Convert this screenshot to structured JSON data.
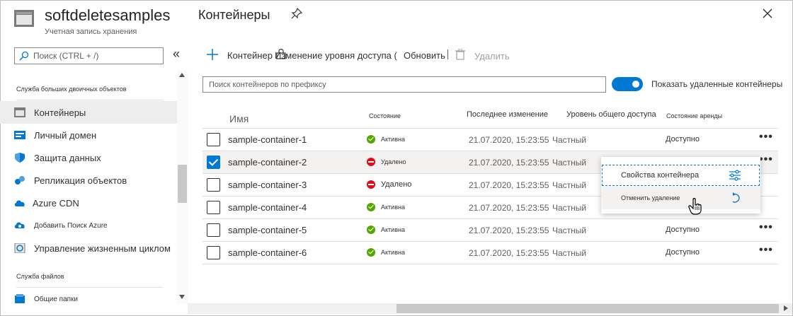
{
  "resource": {
    "title": "softdeletesamples",
    "subtitle": "Учетная запись хранения"
  },
  "page": {
    "title": "Контейнеры"
  },
  "sidebar": {
    "search_placeholder": "Поиск (CTRL + /)",
    "collapse_label": "«",
    "section_blob": "Служба больших двоичных объектов",
    "items": [
      {
        "label": "Контейнеры",
        "icon": "container-icon",
        "selected": true
      },
      {
        "label": "Личный домен",
        "icon": "custom-domain-icon"
      },
      {
        "label": "Защита данных",
        "icon": "shield-icon"
      },
      {
        "label": "Репликация объектов",
        "icon": "replication-icon"
      },
      {
        "label": "Azure CDN",
        "icon": "cloud-icon"
      },
      {
        "label": "Добавить Поиск Azure",
        "icon": "cloud-search-icon"
      },
      {
        "label": "Управление жизненным циклом",
        "icon": "lifecycle-icon"
      }
    ],
    "section_files": "Служба файлов",
    "file_items": [
      {
        "label": "Общие папки",
        "icon": "file-share-icon"
      }
    ]
  },
  "toolbar": {
    "add_container": "Контейнер",
    "change_access": "Изменение уровня доступа (",
    "refresh": "Обновить",
    "delete": "Удалить"
  },
  "filter": {
    "placeholder": "Поиск контейнеров по префиксу",
    "show_deleted_label": "Показать удаленные контейнеры",
    "show_deleted_on": true
  },
  "table": {
    "headers": {
      "name": "Имя",
      "state": "Состояние",
      "modified": "Последнее изменение",
      "access": "Уровень общего доступа",
      "lease": "Состояние аренды"
    },
    "rows": [
      {
        "name": "sample-container-1",
        "state": "Активна",
        "status": "ok",
        "modified": "21.07.2020, 15:23:55",
        "access": "Частный",
        "lease": "Доступно",
        "checked": false
      },
      {
        "name": "sample-container-2",
        "state": "Удалено",
        "status": "deleted",
        "modified": "21.07.2020, 15:23:55",
        "access": "Частный",
        "lease": "",
        "checked": true
      },
      {
        "name": "sample-container-3",
        "state": "Удалено",
        "status": "deleted",
        "modified": "21.07.2020, 15:23:55",
        "access": "Частный",
        "lease": "",
        "checked": false
      },
      {
        "name": "sample-container-4",
        "state": "Активна",
        "status": "ok",
        "modified": "21.07.2020, 15:23:55",
        "access": "Частный",
        "lease": "",
        "checked": false
      },
      {
        "name": "sample-container-5",
        "state": "Активна",
        "status": "ok",
        "modified": "21.07.2020, 15:23:55",
        "access": "Частный",
        "lease": "Доступно",
        "checked": false
      },
      {
        "name": "sample-container-6",
        "state": "Активна",
        "status": "ok",
        "modified": "21.07.2020, 15:23:55",
        "access": "Частный",
        "lease": "Доступно",
        "checked": false
      }
    ],
    "more_label": "•••"
  },
  "context_menu": {
    "properties": "Свойства контейнера",
    "undelete": "Отменить удаление"
  },
  "colors": {
    "accent": "#0078d4",
    "ok": "#57a300",
    "deleted": "#e00b1c"
  }
}
